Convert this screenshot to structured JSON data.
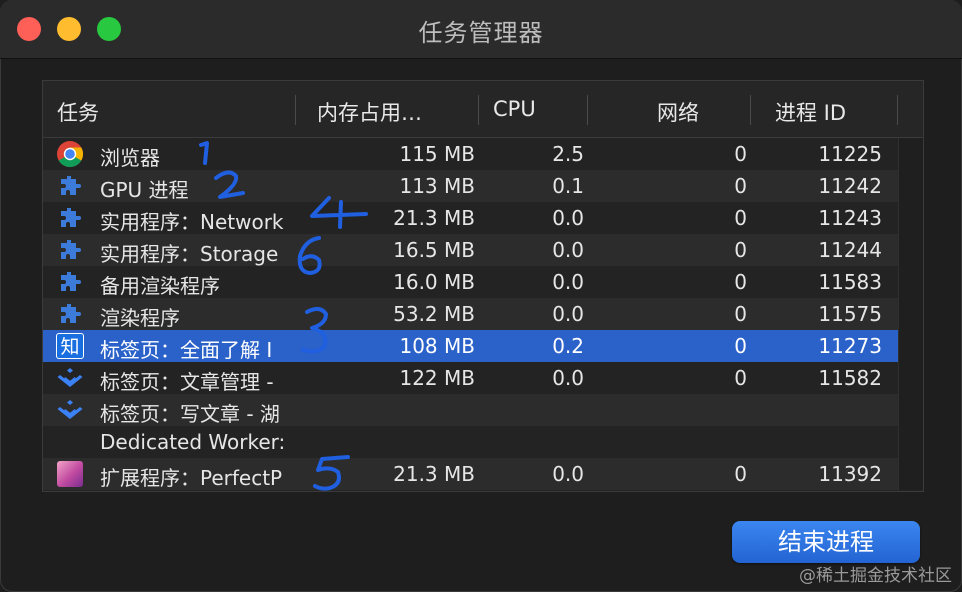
{
  "window": {
    "title": "任务管理器"
  },
  "columns": {
    "task": "任务",
    "memory": "内存占用…",
    "cpu": "CPU",
    "network": "网络",
    "pid": "进程 ID"
  },
  "rows": [
    {
      "icon": "chrome-icon",
      "name": "浏览器",
      "memory": "115 MB",
      "cpu": "2.5",
      "network": "0",
      "pid": "11225"
    },
    {
      "icon": "puzzle-icon",
      "name": "GPU 进程",
      "memory": "113 MB",
      "cpu": "0.1",
      "network": "0",
      "pid": "11242"
    },
    {
      "icon": "puzzle-icon",
      "name": "实用程序：Network",
      "memory": "21.3 MB",
      "cpu": "0.0",
      "network": "0",
      "pid": "11243"
    },
    {
      "icon": "puzzle-icon",
      "name": "实用程序：Storage",
      "memory": "16.5 MB",
      "cpu": "0.0",
      "network": "0",
      "pid": "11244"
    },
    {
      "icon": "puzzle-icon",
      "name": "备用渲染程序",
      "memory": "16.0 MB",
      "cpu": "0.0",
      "network": "0",
      "pid": "11583"
    },
    {
      "icon": "puzzle-icon",
      "name": "渲染程序",
      "memory": "53.2 MB",
      "cpu": "0.0",
      "network": "0",
      "pid": "11575"
    },
    {
      "icon": "zhihu-icon",
      "icon_text": "知",
      "name": "标签页：全面了解 I",
      "memory": "108 MB",
      "cpu": "0.2",
      "network": "0",
      "pid": "11273",
      "selected": true
    },
    {
      "icon": "juejin-icon",
      "name": "标签页：文章管理 -",
      "memory": "122 MB",
      "cpu": "0.0",
      "network": "0",
      "pid": "11582"
    },
    {
      "icon": "juejin-icon",
      "name": "标签页：写文章 - 湖",
      "memory": "",
      "cpu": "",
      "network": "",
      "pid": ""
    },
    {
      "icon": "",
      "name": "Dedicated Worker:",
      "memory": "",
      "cpu": "",
      "network": "",
      "pid": ""
    },
    {
      "icon": "extension-icon",
      "name": "扩展程序：PerfectP",
      "memory": "21.3 MB",
      "cpu": "0.0",
      "network": "0",
      "pid": "11392"
    }
  ],
  "actions": {
    "end_process": "结束进程"
  },
  "watermark": "@稀土掘金技术社区",
  "colors": {
    "selection": "#2a62c9",
    "button": "#2f74e3",
    "annotation": "#1f5fe0"
  }
}
